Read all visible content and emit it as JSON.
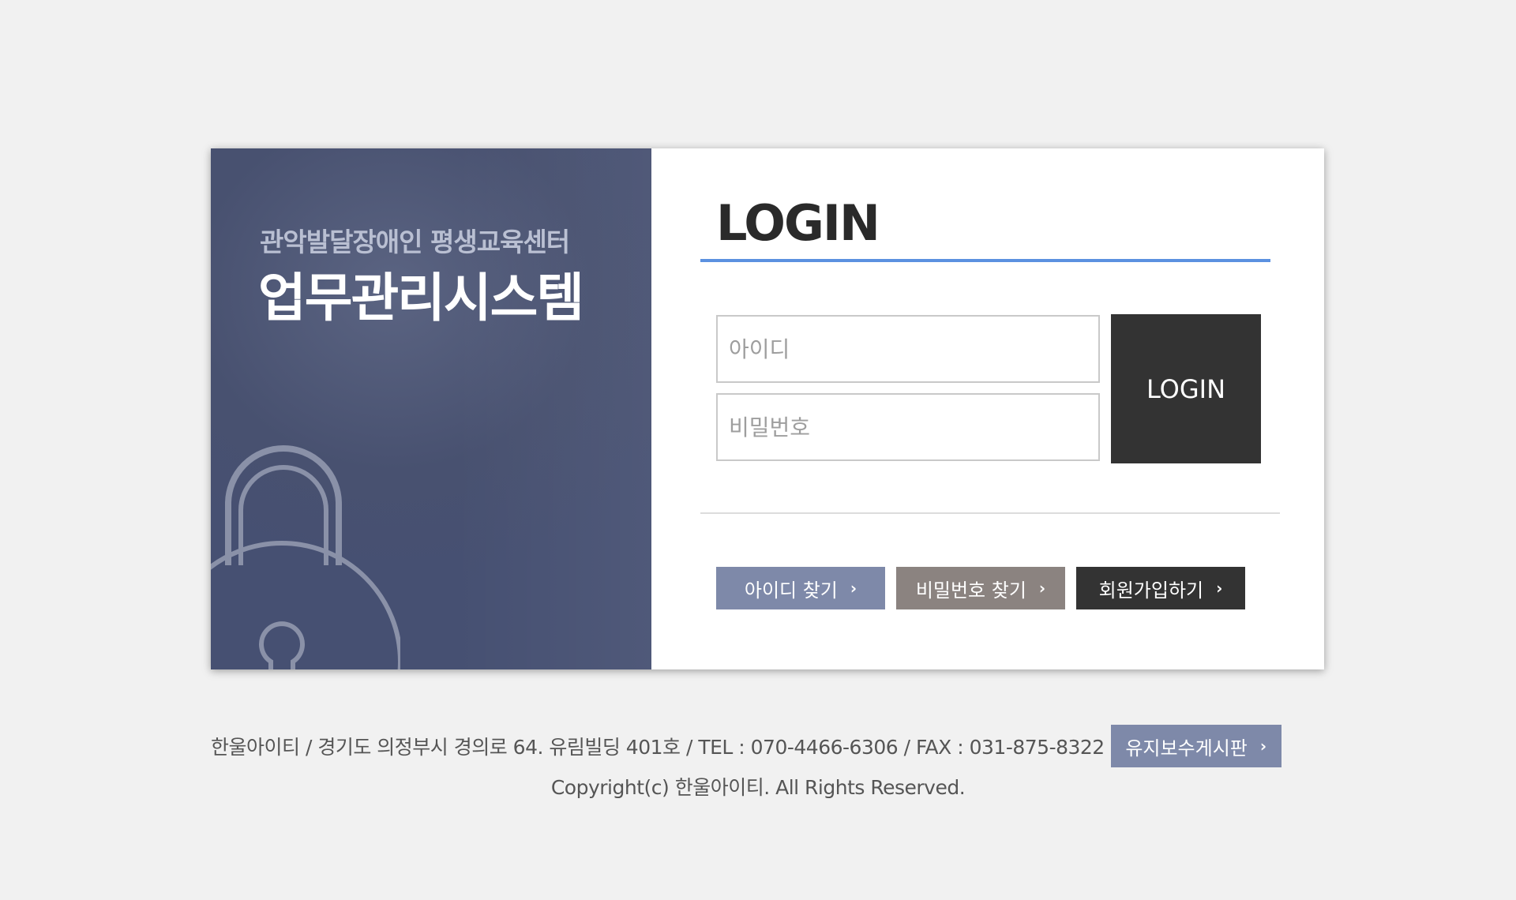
{
  "branding": {
    "org_name": "관악발달장애인 평생교육센터",
    "system_name": "업무관리시스템",
    "panel_color": "#485170"
  },
  "login": {
    "title": "LOGIN",
    "accent_color": "#5b91e0",
    "id_placeholder": "아이디",
    "pw_placeholder": "비밀번호",
    "id_value": "",
    "pw_value": "",
    "submit_label": "LOGIN"
  },
  "actions": {
    "find_id": {
      "label": "아이디 찾기",
      "icon": "chevron-right-icon",
      "color": "#7e89a9"
    },
    "find_pw": {
      "label": "비밀번호 찾기",
      "icon": "chevron-right-icon",
      "color": "#8b8380"
    },
    "signup": {
      "label": "회원가입하기",
      "icon": "chevron-right-icon",
      "color": "#333333"
    }
  },
  "footer": {
    "address": "한울아이티 / 경기도 의정부시 경의로 64. 유림빌딩 401호 / TEL : 070-4466-6306 / FAX : 031-875-8322",
    "maintenance_label": "유지보수게시판",
    "copyright": "Copyright(c) 한울아이티. All Rights Reserved."
  },
  "icons": {
    "lock": "lock-icon",
    "chevron": "chevron-right-icon"
  }
}
